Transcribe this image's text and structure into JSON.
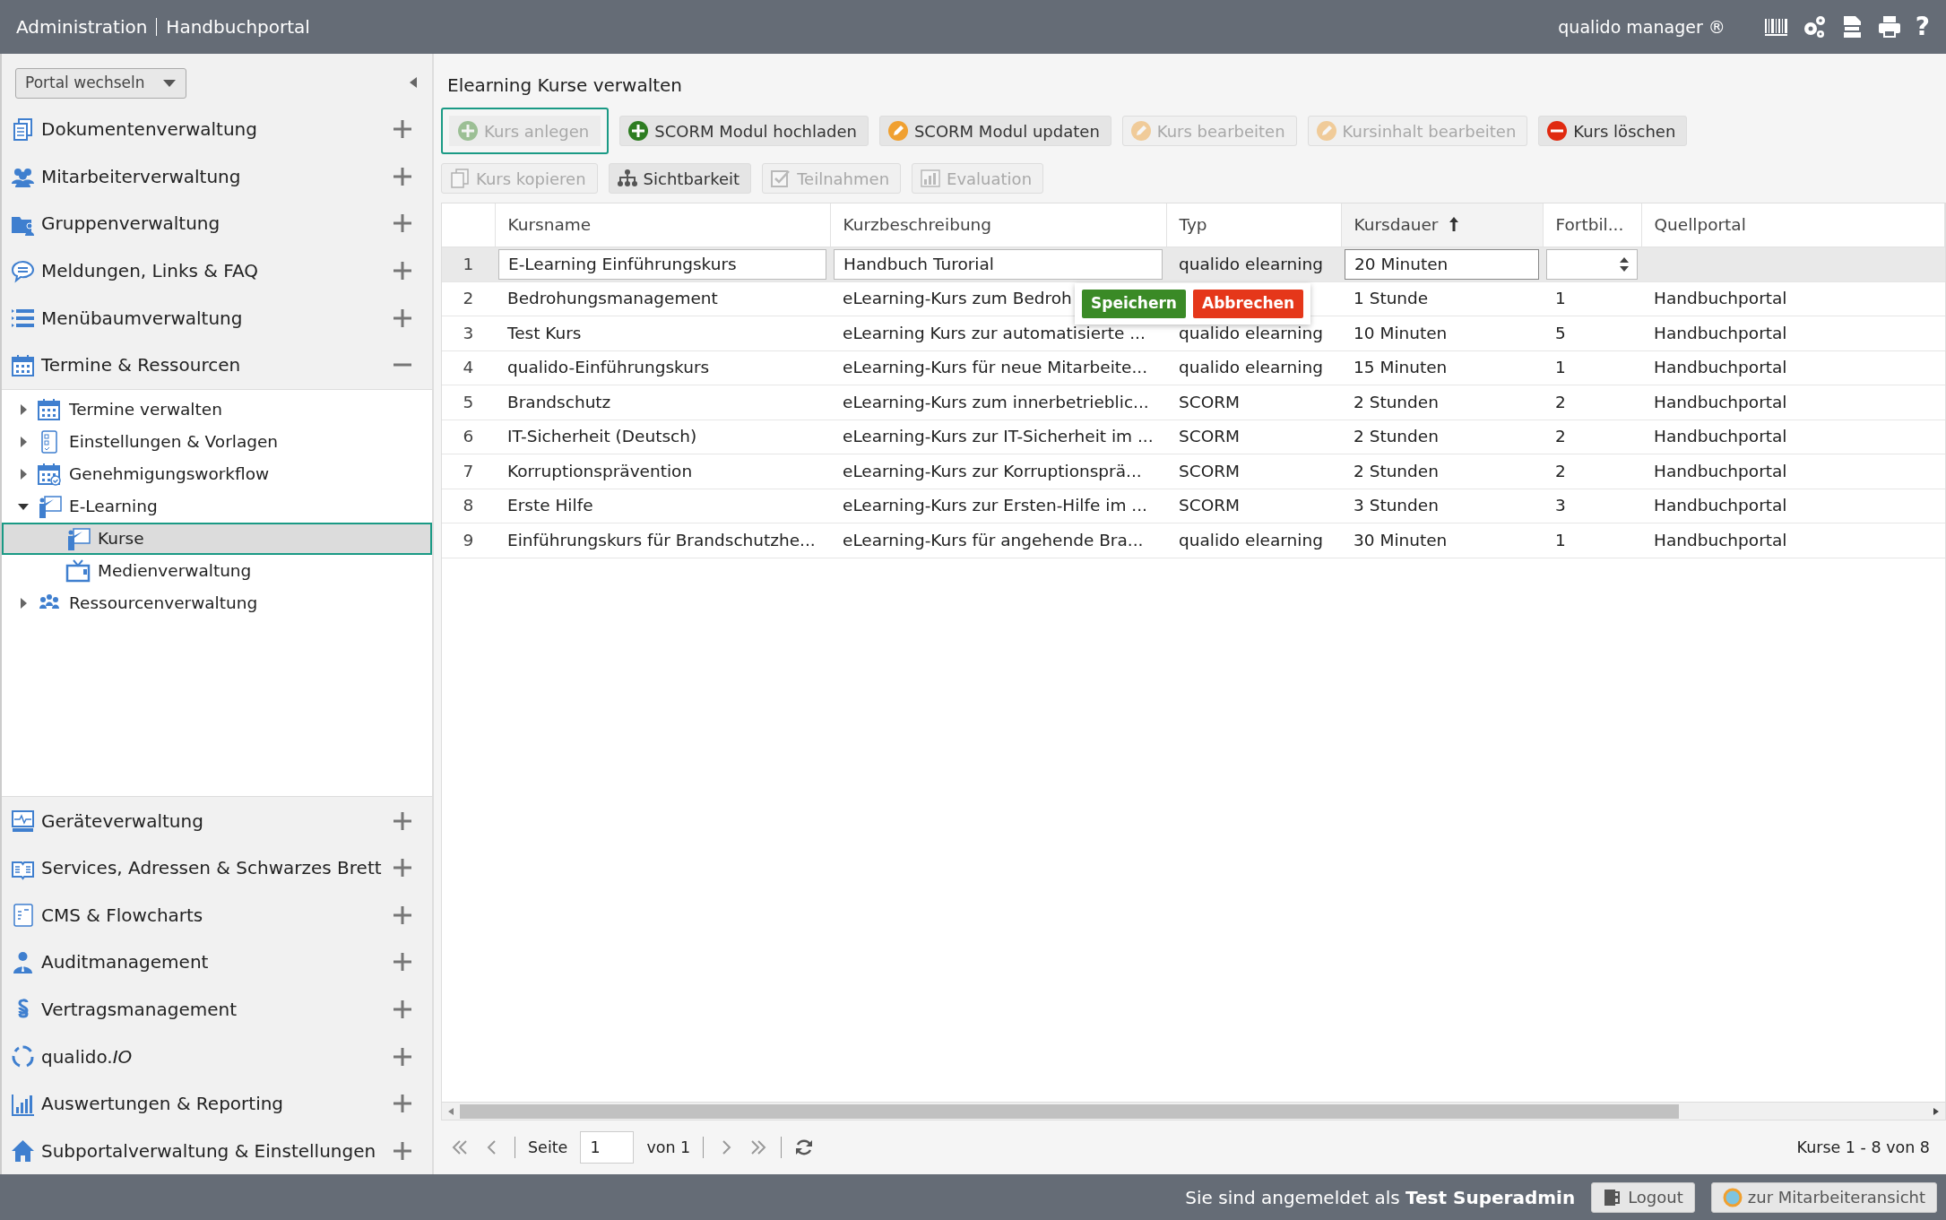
{
  "header": {
    "title": "Administration",
    "portal": "Handbuchportal",
    "product": "qualido manager ®",
    "help": "?"
  },
  "sidebar": {
    "portal_switch": "Portal wechseln",
    "sections": [
      {
        "label": "Dokumentenverwaltung",
        "expanded": false
      },
      {
        "label": "Mitarbeiterverwaltung",
        "expanded": false
      },
      {
        "label": "Gruppenverwaltung",
        "expanded": false
      },
      {
        "label": "Meldungen, Links & FAQ",
        "expanded": false
      },
      {
        "label": "Menübaumverwaltung",
        "expanded": false
      },
      {
        "label": "Termine & Ressourcen",
        "expanded": true,
        "children": [
          {
            "label": "Termine verwalten",
            "expanded": false,
            "selected": false
          },
          {
            "label": "Einstellungen & Vorlagen",
            "expanded": false,
            "selected": false
          },
          {
            "label": "Genehmigungsworkflow",
            "expanded": false,
            "selected": false
          },
          {
            "label": "E-Learning",
            "expanded": true,
            "selected": false,
            "children": [
              {
                "label": "Kurse",
                "selected": true
              },
              {
                "label": "Medienverwaltung",
                "selected": false
              }
            ]
          },
          {
            "label": "Ressourcenverwaltung",
            "expanded": false,
            "selected": false
          }
        ]
      },
      {
        "label": "Geräteverwaltung",
        "expanded": false
      },
      {
        "label": "Services, Adressen & Schwarzes Brett",
        "expanded": false
      },
      {
        "label": "CMS & Flowcharts",
        "expanded": false
      },
      {
        "label": "Auditmanagement",
        "expanded": false
      },
      {
        "label": "Vertragsmanagement",
        "expanded": false
      },
      {
        "label": "qualido.*IO*",
        "expanded": false
      },
      {
        "label": "Auswertungen & Reporting",
        "expanded": false
      },
      {
        "label": "Subportalverwaltung & Einstellungen",
        "expanded": false
      }
    ]
  },
  "main": {
    "title": "Elearning Kurse verwalten",
    "toolbar": [
      [
        {
          "label": "Kurs anlegen",
          "disabled": true,
          "focused": true
        },
        {
          "label": "SCORM Modul hochladen",
          "disabled": false,
          "focused": false
        },
        {
          "label": "SCORM Modul updaten",
          "disabled": false,
          "focused": false
        },
        {
          "label": "Kurs bearbeiten",
          "disabled": true,
          "focused": false
        },
        {
          "label": "Kursinhalt bearbeiten",
          "disabled": true,
          "focused": false
        },
        {
          "label": "Kurs löschen",
          "disabled": false,
          "focused": false
        }
      ],
      [
        {
          "label": "Kurs kopieren",
          "disabled": true,
          "focused": false
        },
        {
          "label": "Sichtbarkeit",
          "disabled": false,
          "focused": false
        },
        {
          "label": "Teilnahmen",
          "disabled": true,
          "focused": false
        },
        {
          "label": "Evaluation",
          "disabled": true,
          "focused": false
        }
      ]
    ],
    "table": {
      "columns": [
        {
          "label": "Kursname",
          "sorted": false
        },
        {
          "label": "Kurzbeschreibung",
          "sorted": false
        },
        {
          "label": "Typ",
          "sorted": false
        },
        {
          "label": "Kursdauer",
          "sorted": true
        },
        {
          "label": "Fortbil...",
          "sorted": false
        },
        {
          "label": "Quellportal",
          "sorted": false
        }
      ],
      "rows": [
        {
          "number": "1",
          "editing": true,
          "cells": [
            "E-Learning Einführungskurs",
            "Handbuch Turorial",
            "qualido elearning",
            "20 Minuten",
            null,
            null
          ]
        },
        {
          "number": "2",
          "editing": false,
          "cells": [
            "Bedrohungsmanagement",
            "eLearning-Kurs zum Bedroh",
            null,
            "1 Stunde",
            "1",
            "Handbuchportal"
          ]
        },
        {
          "number": "3",
          "editing": false,
          "cells": [
            "Test Kurs",
            "eLearning Kurs zur automatisierte ...",
            "qualido elearning",
            "10 Minuten",
            "5",
            "Handbuchportal"
          ]
        },
        {
          "number": "4",
          "editing": false,
          "cells": [
            "qualido-Einführungskurs",
            "eLearning-Kurs für neue Mitarbeite...",
            "qualido elearning",
            "15 Minuten",
            "1",
            "Handbuchportal"
          ]
        },
        {
          "number": "5",
          "editing": false,
          "cells": [
            "Brandschutz",
            "eLearning-Kurs zum innerbetrieblic...",
            "SCORM",
            "2 Stunden",
            "2",
            "Handbuchportal"
          ]
        },
        {
          "number": "6",
          "editing": false,
          "cells": [
            "IT-Sicherheit (Deutsch)",
            "eLearning-Kurs zur IT-Sicherheit im ...",
            "SCORM",
            "2 Stunden",
            "2",
            "Handbuchportal"
          ]
        },
        {
          "number": "7",
          "editing": false,
          "cells": [
            "Korruptionsprävention",
            "eLearning-Kurs zur Korruptionsprä...",
            "SCORM",
            "2 Stunden",
            "2",
            "Handbuchportal"
          ]
        },
        {
          "number": "8",
          "editing": false,
          "cells": [
            "Erste Hilfe",
            "eLearning-Kurs zur Ersten-Hilfe im ...",
            "SCORM",
            "3 Stunden",
            "3",
            "Handbuchportal"
          ]
        },
        {
          "number": "9",
          "editing": false,
          "cells": [
            "Einführungskurs für Brandschutzhe...",
            "eLearning-Kurs für angehende Bra...",
            "qualido elearning",
            "30 Minuten",
            "1",
            "Handbuchportal"
          ]
        }
      ],
      "edit_popup": {
        "save": "Speichern",
        "cancel": "Abbrechen"
      }
    },
    "pager": {
      "page_label": "Seite",
      "page": "1",
      "of": "von 1",
      "summary": "Kurse 1 - 8 von 8"
    }
  },
  "footer": {
    "login_text": "Sie sind angemeldet als **Test Superadmin**",
    "logout": "Logout",
    "switch_view": "zur Mitarbeiteransicht"
  }
}
